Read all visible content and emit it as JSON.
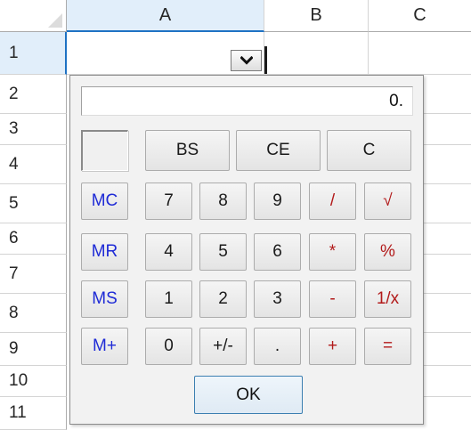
{
  "sheet": {
    "columns": [
      "A",
      "B",
      "C"
    ],
    "rows": [
      "1",
      "2",
      "3",
      "4",
      "5",
      "6",
      "7",
      "8",
      "9",
      "10",
      "11"
    ],
    "active_column": "A",
    "active_row": "1",
    "dropdown_icon": "chevron-down-icon"
  },
  "calculator": {
    "display": "0.",
    "top_buttons": [
      "BS",
      "CE",
      "C"
    ],
    "memory_buttons": [
      "MC",
      "MR",
      "MS",
      "M+"
    ],
    "digit_rows": [
      [
        "7",
        "8",
        "9"
      ],
      [
        "4",
        "5",
        "6"
      ],
      [
        "1",
        "2",
        "3"
      ],
      [
        "0",
        "+/-",
        "."
      ]
    ],
    "operator_rows": [
      [
        "/",
        "√"
      ],
      [
        "*",
        "%"
      ],
      [
        "-",
        "1/x"
      ],
      [
        "+",
        "="
      ]
    ],
    "ok_label": "OK",
    "colors": {
      "memory_text": "#1f2bd6",
      "operator_text": "#b21a1a",
      "selection_accent": "#1e72c4",
      "selection_fill": "#e1eefa"
    }
  }
}
